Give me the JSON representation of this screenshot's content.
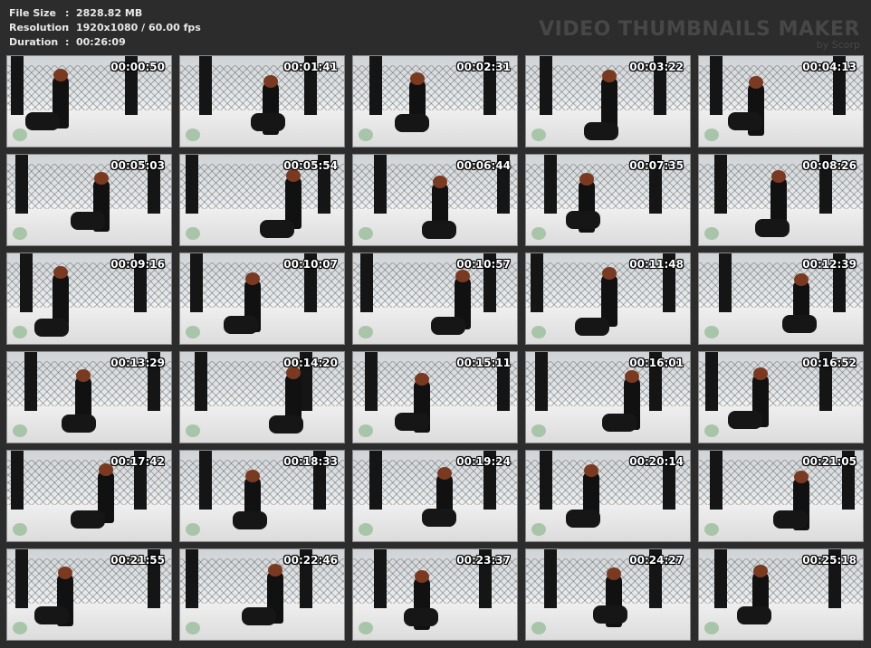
{
  "file_info": {
    "file_size_label": "File Size",
    "file_size": "2828.82 MB",
    "resolution_label": "Resolution",
    "resolution": "1920x1080 / 60.00 fps",
    "duration_label": "Duration",
    "duration": "00:26:09",
    "separator": ":"
  },
  "watermark": {
    "title": "VIDEO THUMBNAILS MAKER",
    "subtitle": "by Scorp"
  },
  "thumbnails": [
    {
      "timestamp": "00:00:50"
    },
    {
      "timestamp": "00:01:41"
    },
    {
      "timestamp": "00:02:31"
    },
    {
      "timestamp": "00:03:22"
    },
    {
      "timestamp": "00:04:13"
    },
    {
      "timestamp": "00:05:03"
    },
    {
      "timestamp": "00:05:54"
    },
    {
      "timestamp": "00:06:44"
    },
    {
      "timestamp": "00:07:35"
    },
    {
      "timestamp": "00:08:26"
    },
    {
      "timestamp": "00:09:16"
    },
    {
      "timestamp": "00:10:07"
    },
    {
      "timestamp": "00:10:57"
    },
    {
      "timestamp": "00:11:48"
    },
    {
      "timestamp": "00:12:39"
    },
    {
      "timestamp": "00:13:29"
    },
    {
      "timestamp": "00:14:20"
    },
    {
      "timestamp": "00:15:11"
    },
    {
      "timestamp": "00:16:01"
    },
    {
      "timestamp": "00:16:52"
    },
    {
      "timestamp": "00:17:42"
    },
    {
      "timestamp": "00:18:33"
    },
    {
      "timestamp": "00:19:24"
    },
    {
      "timestamp": "00:20:14"
    },
    {
      "timestamp": "00:21:05"
    },
    {
      "timestamp": "00:21:55"
    },
    {
      "timestamp": "00:22:46"
    },
    {
      "timestamp": "00:23:37"
    },
    {
      "timestamp": "00:24:27"
    },
    {
      "timestamp": "00:25:18"
    }
  ]
}
